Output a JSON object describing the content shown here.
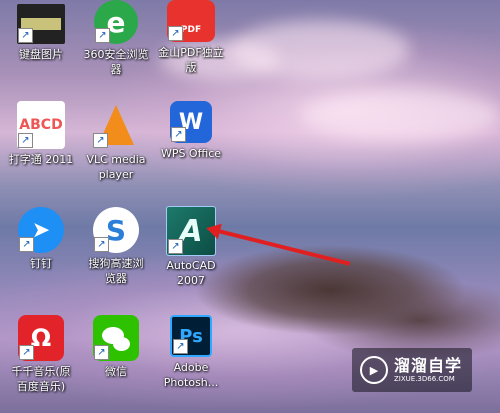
{
  "desktop": {
    "icons": [
      {
        "label": "键盘图片",
        "icon": "keyboard-image-icon"
      },
      {
        "label": "360安全浏览\n器",
        "icon": "360-browser-icon"
      },
      {
        "label": "金山PDF独立\n版",
        "icon": "kingsoft-pdf-icon",
        "badge": "PDF"
      },
      {
        "label": "打字通 2011",
        "icon": "typing-tutor-icon",
        "letters": "ABCD"
      },
      {
        "label": "VLC media\nplayer",
        "icon": "vlc-icon"
      },
      {
        "label": "WPS Office",
        "icon": "wps-office-icon",
        "letters": "W"
      },
      {
        "label": "钉钉",
        "icon": "dingtalk-icon"
      },
      {
        "label": "搜狗高速浏\n览器",
        "icon": "sogou-browser-icon",
        "letters": "S"
      },
      {
        "label": "AutoCAD\n2007",
        "icon": "autocad-icon",
        "letters": "A"
      },
      {
        "label": "千千音乐(原\n百度音乐)",
        "icon": "qianqian-music-icon",
        "letters": "Ω"
      },
      {
        "label": "微信",
        "icon": "wechat-icon"
      },
      {
        "label": "Adobe\nPhotosh...",
        "icon": "photoshop-icon",
        "letters": "Ps"
      }
    ]
  },
  "watermark": {
    "title": "溜溜自学",
    "url": "ZIXUE.3D66.COM"
  },
  "colors": {
    "arrow": "#e02020"
  }
}
